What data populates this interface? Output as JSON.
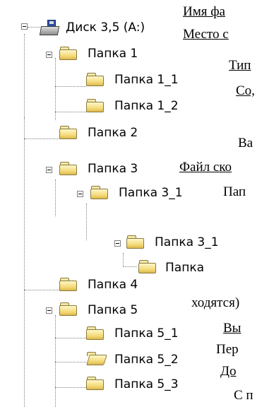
{
  "tree": {
    "root": "Диск 3,5 (A:)",
    "folder1": "Папка 1",
    "folder1_1": "Папка 1_1",
    "folder1_2": "Папка 1_2",
    "folder2": "Папка 2",
    "folder3": "Папка 3",
    "folder3_1": "Папка 3_1",
    "folder3_1_1": "Папка 3_1",
    "folder3_1_1_1": "Папка",
    "folder4": "Папка 4",
    "folder5": "Папка 5",
    "folder5_1": "Папка 5_1",
    "folder5_2": "Папка 5_2",
    "folder5_3": "Папка 5_3"
  },
  "overlay": {
    "t1": "Имя фа",
    "t2": "Место с",
    "t3": "Тип",
    "t4": "Со,",
    "t5": "Ва",
    "t6": "Файл ско",
    "t7": "Пап",
    "t8": "ходятся)",
    "t9": "Вы",
    "t10": "Пер",
    "t11": "До",
    "t12": "С п"
  },
  "colors": {
    "folder_fill": "#f3d977",
    "guide": "#808080"
  },
  "icons": {
    "drive": "floppy-drive-icon",
    "folder": "folder-icon",
    "folder_open": "open-folder-icon",
    "toggle": "collapse-toggle-icon"
  }
}
